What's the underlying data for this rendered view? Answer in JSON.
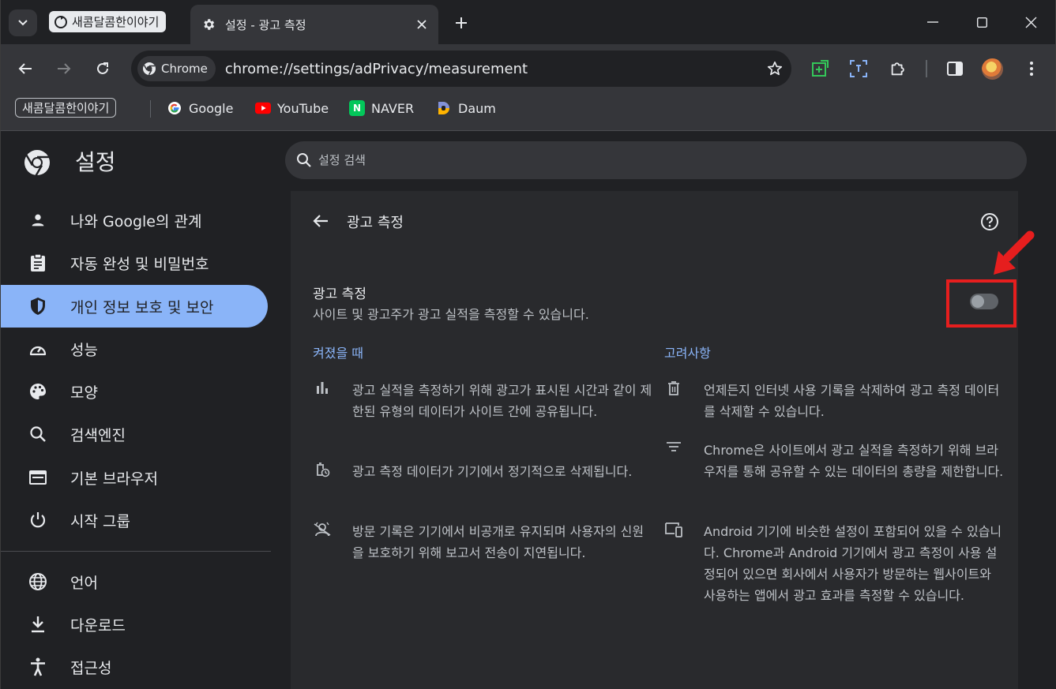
{
  "browser": {
    "tab_group_label": "새콤달콤한이야기",
    "active_tab_title": "설정 - 광고 측정",
    "omnibox_chip": "Chrome",
    "url": "chrome://settings/adPrivacy/measurement"
  },
  "bookmarks": {
    "group_label": "새콤달콤한이야기",
    "items": [
      {
        "label": "Google"
      },
      {
        "label": "YouTube"
      },
      {
        "label": "NAVER"
      },
      {
        "label": "Daum"
      }
    ]
  },
  "settings": {
    "title": "설정",
    "search_placeholder": "설정 검색"
  },
  "sidebar": {
    "items": [
      {
        "label": "나와 Google의 관계",
        "icon": "person-icon"
      },
      {
        "label": "자동 완성 및 비밀번호",
        "icon": "clipboard-icon"
      },
      {
        "label": "개인 정보 보호 및 보안",
        "icon": "shield-icon",
        "active": true
      },
      {
        "label": "성능",
        "icon": "speedometer-icon"
      },
      {
        "label": "모양",
        "icon": "palette-icon"
      },
      {
        "label": "검색엔진",
        "icon": "search-icon"
      },
      {
        "label": "기본 브라우저",
        "icon": "browser-icon"
      },
      {
        "label": "시작 그룹",
        "icon": "power-icon"
      },
      {
        "label": "언어",
        "icon": "globe-icon"
      },
      {
        "label": "다운로드",
        "icon": "download-icon"
      },
      {
        "label": "접근성",
        "icon": "accessibility-icon"
      }
    ]
  },
  "page": {
    "title": "광고 측정",
    "setting_title": "광고 측정",
    "setting_desc": "사이트 및 광고주가 광고 실적을 측정할 수 있습니다.",
    "toggle_on": false,
    "when_on_heading": "켜졌을 때",
    "considerations_heading": "고려사항",
    "when_on": [
      {
        "icon": "bar-chart-icon",
        "text": "광고 실적을 측정하기 위해 광고가 표시된 시간과 같이 제한된 유형의 데이터가 사이트 간에 공유됩니다."
      },
      {
        "icon": "timed-delete-icon",
        "text": "광고 측정 데이터가 기기에서 정기적으로 삭제됩니다."
      },
      {
        "icon": "private-history-icon",
        "text": "방문 기록은 기기에서 비공개로 유지되며 사용자의 신원을 보호하기 위해 보고서 전송이 지연됩니다."
      }
    ],
    "considerations": [
      {
        "icon": "trash-icon",
        "text": "언제든지 인터넷 사용 기록을 삭제하여 광고 측정 데이터를 삭제할 수 있습니다."
      },
      {
        "icon": "filter-icon",
        "text": "Chrome은 사이트에서 광고 실적을 측정하기 위해 브라우저를 통해 공유할 수 있는 데이터의 총량을 제한합니다."
      },
      {
        "icon": "devices-icon",
        "text": "Android 기기에 비슷한 설정이 포함되어 있을 수 있습니다. Chrome과 Android 기기에서 광고 측정이 사용 설정되어 있으면 회사에서 사용자가 방문하는 웹사이트와 사용하는 앱에서 광고 효과를 측정할 수 있습니다."
      }
    ]
  },
  "colors": {
    "accent": "#8ab4f8",
    "highlight": "#e61e1e"
  }
}
